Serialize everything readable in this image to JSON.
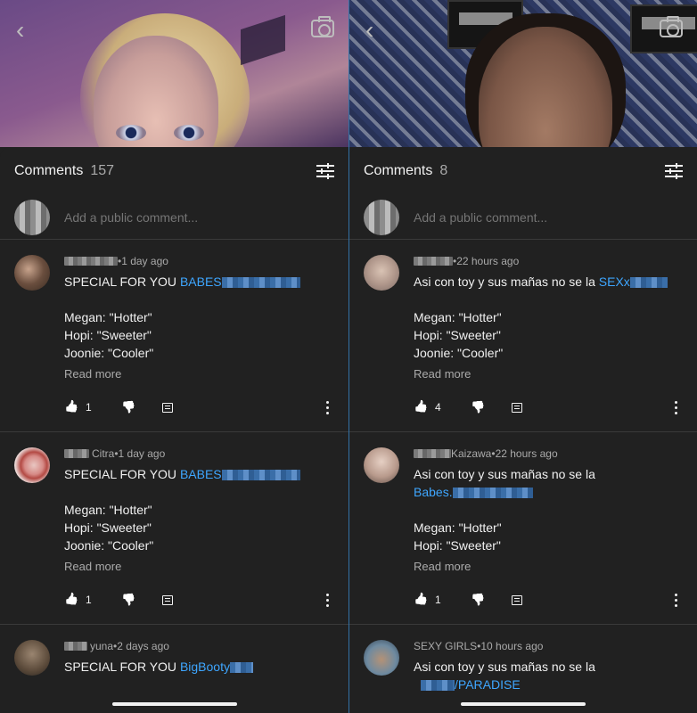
{
  "left": {
    "header": {
      "title": "Comments",
      "count": "157"
    },
    "add_comment": {
      "placeholder": "Add a public comment..."
    },
    "comments": [
      {
        "author": "",
        "time": "1 day ago",
        "prefix": "SPECIAL FOR YOU ",
        "link": "BABES",
        "lines": [
          "Megan: \"Hotter\"",
          "Hopi: \"Sweeter\"",
          "Joonie: \"Cooler\""
        ],
        "read_more": "Read more",
        "likes": "1"
      },
      {
        "author": "Citra",
        "time": "1 day ago",
        "prefix": "SPECIAL FOR YOU ",
        "link": "BABES",
        "lines": [
          "Megan: \"Hotter\"",
          "Hopi: \"Sweeter\"",
          "Joonie: \"Cooler\""
        ],
        "read_more": "Read more",
        "likes": "1"
      },
      {
        "author": "yuna",
        "time": "2 days ago",
        "prefix": "SPECIAL FOR YOU ",
        "link": "BigBooty"
      }
    ]
  },
  "right": {
    "header": {
      "title": "Comments",
      "count": "8"
    },
    "add_comment": {
      "placeholder": "Add a public comment..."
    },
    "comments": [
      {
        "author": "",
        "time": "22 hours ago",
        "prefix": "Asi con toy y sus mañas no se la ",
        "link": "SEXx",
        "lines": [
          "Megan: \"Hotter\"",
          "Hopi: \"Sweeter\"",
          "Joonie: \"Cooler\""
        ],
        "read_more": "Read more",
        "likes": "4"
      },
      {
        "author": "Kaizawa",
        "time": "22 hours ago",
        "text_line": "Asi con toy y sus mañas no se la",
        "link": "Babes.",
        "lines": [
          "Megan: \"Hotter\"",
          "Hopi: \"Sweeter\""
        ],
        "read_more": "Read more",
        "likes": "1"
      },
      {
        "author": "SEXY GIRLS",
        "time": "10 hours ago",
        "text_line": "Asi con toy y sus mañas no se la",
        "link": "/PARADISE"
      }
    ]
  },
  "time_separator": " • ",
  "icons": [
    "back-arrow-icon",
    "camera-icon",
    "sort-filter-icon",
    "thumbs-up-icon",
    "thumbs-down-icon",
    "reply-icon",
    "more-vert-icon"
  ],
  "colors": {
    "background": "#212121",
    "text": "#f1f1f1",
    "secondary_text": "#aaaaaa",
    "link": "#3ea6ff"
  }
}
